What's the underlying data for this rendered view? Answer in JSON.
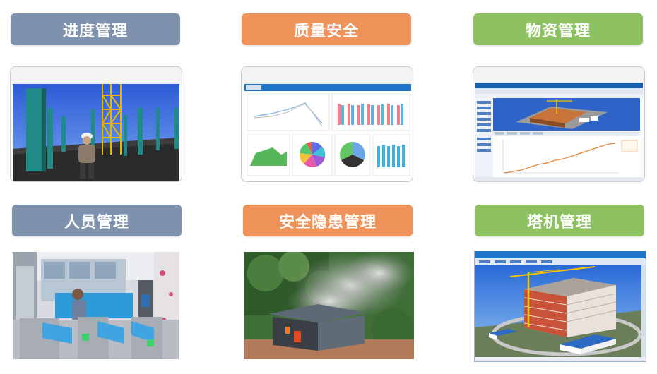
{
  "cards": [
    {
      "label": "进度管理"
    },
    {
      "label": "质量安全"
    },
    {
      "label": "物资管理"
    },
    {
      "label": "人员管理"
    },
    {
      "label": "安全隐患管理"
    },
    {
      "label": "塔机管理"
    }
  ],
  "colors": {
    "slate": "#7f92ad",
    "orange": "#f0935a",
    "green": "#8dc162",
    "app_blue": "#1c73c9"
  }
}
